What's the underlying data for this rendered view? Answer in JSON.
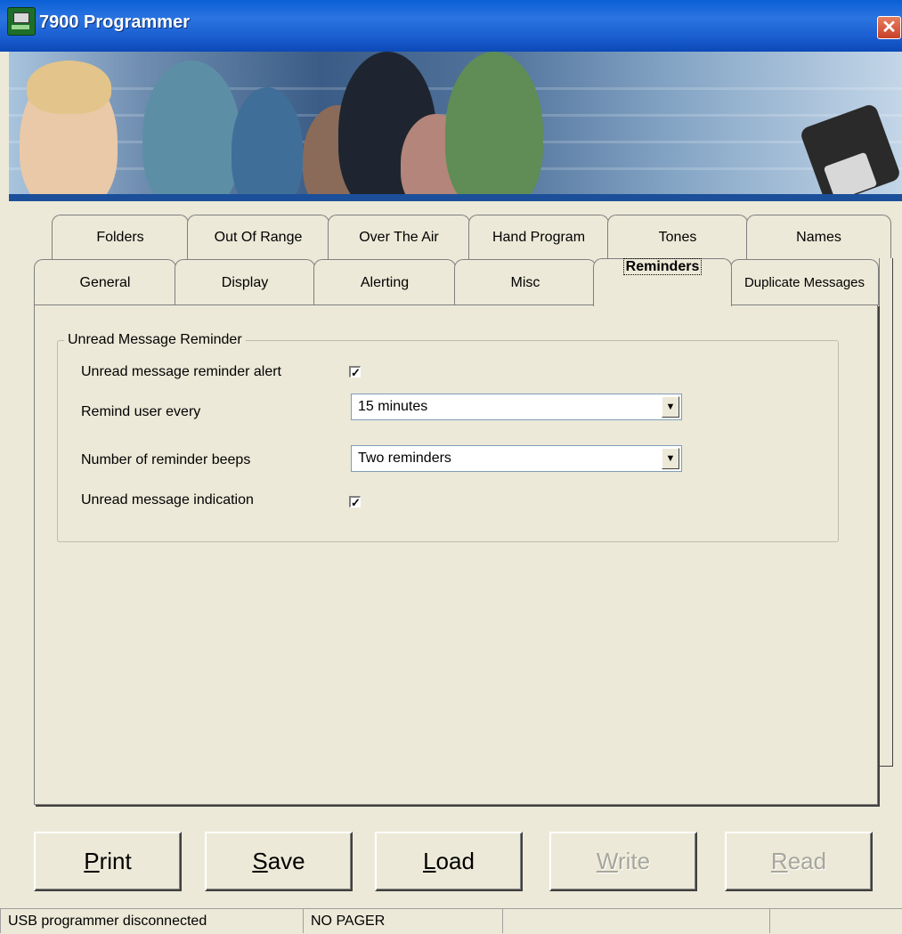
{
  "window": {
    "title": "7900 Programmer",
    "close_glyph": "✕"
  },
  "tabs_row1": [
    "Folders",
    "Out Of Range",
    "Over The Air",
    "Hand Program",
    "Tones",
    "Names"
  ],
  "tabs_row2": [
    "General",
    "Display",
    "Alerting",
    "Misc",
    "Reminders",
    "Duplicate Messages"
  ],
  "active_tab": "Reminders",
  "group": {
    "title": "Unread Message Reminder",
    "unread_alert_label": "Unread message reminder alert",
    "unread_alert_checked": true,
    "remind_every_label": "Remind user every",
    "remind_every_value": "15 minutes",
    "beeps_label": "Number of reminder beeps",
    "beeps_value": "Two reminders",
    "indication_label": "Unread message indication",
    "indication_checked": true,
    "check_glyph": "✓",
    "arrow_glyph": "▼"
  },
  "buttons": {
    "print": {
      "accel": "P",
      "rest": "rint"
    },
    "save": {
      "accel": "S",
      "rest": "ave"
    },
    "load": {
      "accel": "L",
      "rest": "oad"
    },
    "write": {
      "accel": "W",
      "rest": "rite",
      "disabled": true
    },
    "read": {
      "accel": "R",
      "rest": "ead",
      "disabled": true
    }
  },
  "status": {
    "connection": "USB programmer disconnected",
    "pager": "NO PAGER",
    "extra": ""
  }
}
